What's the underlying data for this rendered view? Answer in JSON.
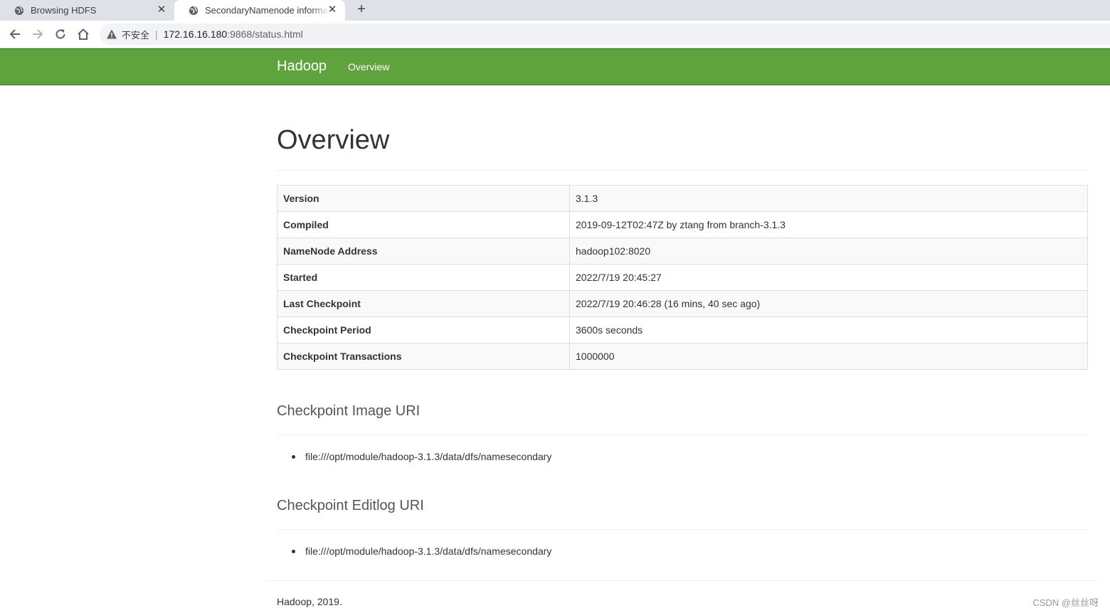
{
  "browser": {
    "tabs": [
      {
        "title": "Browsing HDFS",
        "active": false
      },
      {
        "title": "SecondaryNamenode information",
        "active": true
      }
    ],
    "new_tab_symbol": "+",
    "close_symbol": "✕",
    "address": {
      "security_label": "不安全",
      "host": "172.16.16.180",
      "path": ":9868/status.html"
    }
  },
  "navbar": {
    "brand": "Hadoop",
    "links": [
      "Overview"
    ],
    "color": "#5fa33e"
  },
  "overview": {
    "title": "Overview",
    "rows": [
      {
        "key": "Version",
        "value": "3.1.3"
      },
      {
        "key": "Compiled",
        "value": "2019-09-12T02:47Z by ztang from branch-3.1.3"
      },
      {
        "key": "NameNode Address",
        "value": "hadoop102:8020"
      },
      {
        "key": "Started",
        "value": "2022/7/19 20:45:27"
      },
      {
        "key": "Last Checkpoint",
        "value": "2022/7/19 20:46:28 (16 mins, 40 sec ago)"
      },
      {
        "key": "Checkpoint Period",
        "value": "3600s seconds"
      },
      {
        "key": "Checkpoint Transactions",
        "value": "1000000"
      }
    ]
  },
  "image_uri": {
    "title": "Checkpoint Image URI",
    "items": [
      "file:///opt/module/hadoop-3.1.3/data/dfs/namesecondary"
    ]
  },
  "editlog_uri": {
    "title": "Checkpoint Editlog URI",
    "items": [
      "file:///opt/module/hadoop-3.1.3/data/dfs/namesecondary"
    ]
  },
  "footer": {
    "text": "Hadoop, 2019.",
    "watermark": "CSDN @丝丝呀"
  },
  "icons": {
    "tab_favicon": "globe-icon",
    "back": "arrow-left-icon",
    "forward": "arrow-right-icon",
    "reload": "reload-icon",
    "home": "home-icon",
    "security": "warning-icon"
  }
}
